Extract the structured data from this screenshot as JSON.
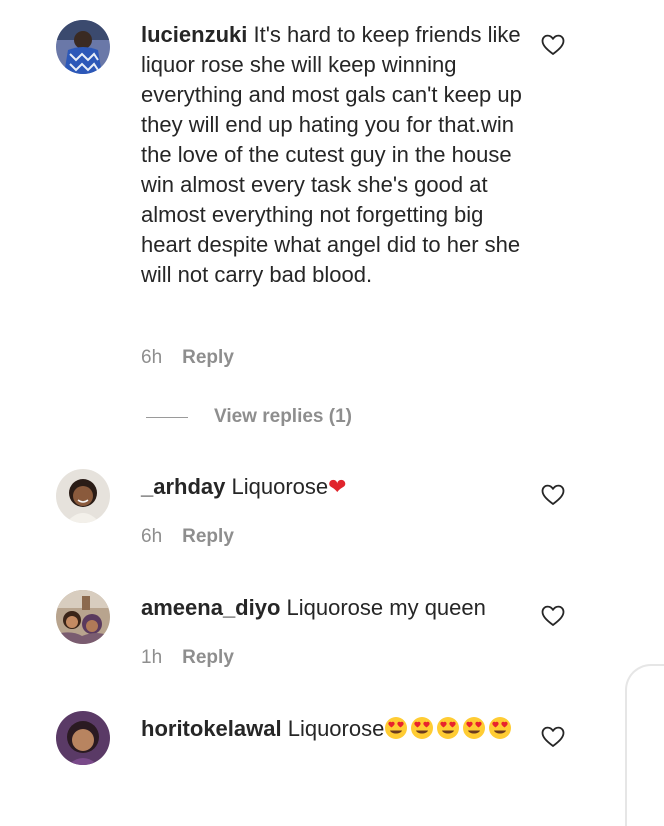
{
  "comments": [
    {
      "username": "lucienzuki",
      "text": " It's hard to keep friends like liquor rose she will keep winning everything and most gals can't keep up they will end up hating you for that.win the love of the cutest guy in the house win almost every task she's good at almost everything not forgetting big heart despite what angel did to her she will not carry bad blood.",
      "time": "6h",
      "reply_label": "Reply",
      "view_replies": "View replies (1)"
    },
    {
      "username": "_arhday",
      "text": " Liquorose",
      "emoji": "❤",
      "time": "6h",
      "reply_label": "Reply"
    },
    {
      "username": "ameena_diyo",
      "text": " Liquorose my queen",
      "time": "1h",
      "reply_label": "Reply"
    },
    {
      "username": "horitokelawal",
      "text": " Liquorose",
      "emoji_names": [
        "heart-eyes-emoji",
        "heart-eyes-emoji",
        "heart-eyes-emoji",
        "heart-eyes-emoji",
        "heart-eyes-emoji"
      ]
    }
  ],
  "colors": {
    "text": "#262626",
    "muted": "#8e8e8e",
    "heart_emoji": "#e0242c"
  },
  "icons": {
    "like": "heart-outline-icon"
  }
}
